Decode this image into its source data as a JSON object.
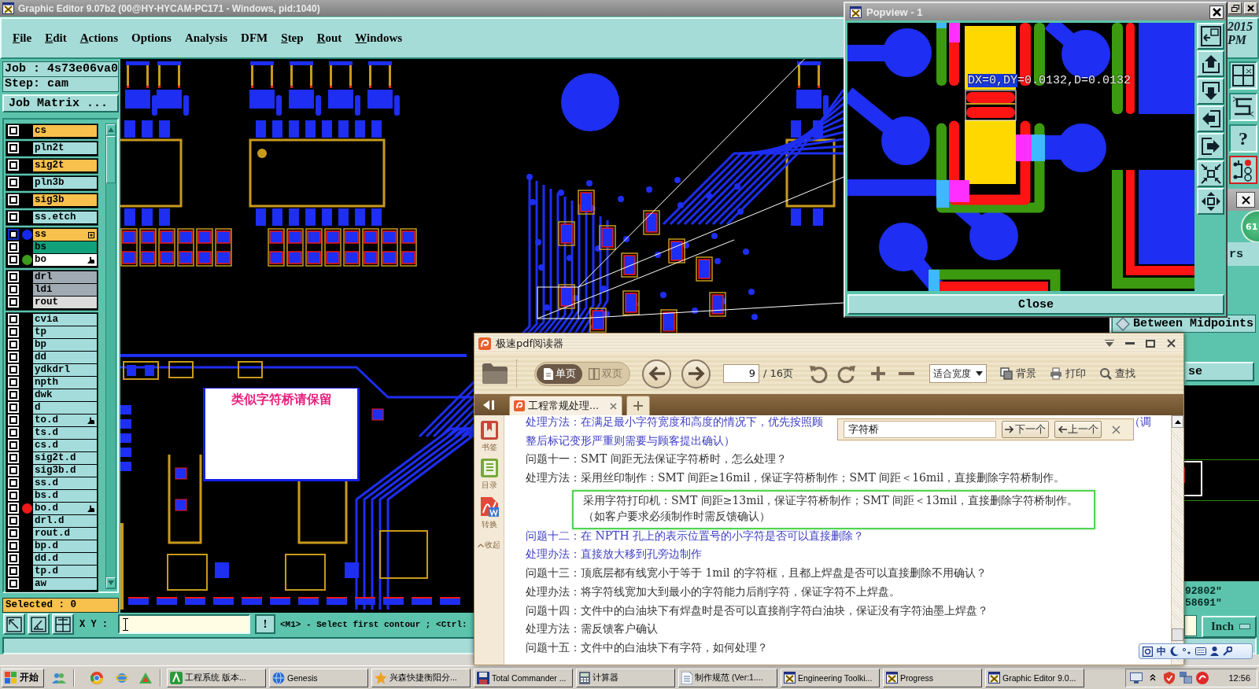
{
  "main_window": {
    "title": "Graphic Editor 9.07b2 (00@HY-HYCAM-PC171 - Windows, pid:1040)",
    "menu": [
      {
        "label": "File",
        "mnemonic": true
      },
      {
        "label": "Edit",
        "mnemonic": true
      },
      {
        "label": "Actions",
        "mnemonic": true
      },
      {
        "label": "Options",
        "mnemonic": false
      },
      {
        "label": "Analysis",
        "mnemonic": false
      },
      {
        "label": "DFM",
        "mnemonic": false
      },
      {
        "label": "Step",
        "mnemonic": true
      },
      {
        "label": "Rout",
        "mnemonic": true
      },
      {
        "label": "Windows",
        "mnemonic": true
      }
    ],
    "clock": {
      "date": "2015",
      "time": "PM"
    },
    "job_field": "Job : 4s73e06va0",
    "step_field": "Step: cam",
    "job_matrix_button": "Job Matrix ...",
    "layer_groups": [
      {
        "layers": [
          {
            "kind": "plain",
            "name": "cs",
            "color": "#f8c04c",
            "checked": false,
            "selected": false
          }
        ]
      },
      {
        "layers": [
          {
            "kind": "plain",
            "name": "pln2t",
            "color": "#a4dcdc",
            "checked": false,
            "selected": false
          }
        ]
      },
      {
        "layers": [
          {
            "kind": "plain",
            "name": "sig2t",
            "color": "#f8c04c",
            "checked": false,
            "selected": false
          }
        ]
      },
      {
        "layers": [
          {
            "kind": "plain",
            "name": "pln3b",
            "color": "#a4dcdc",
            "checked": false,
            "selected": false
          }
        ]
      },
      {
        "layers": [
          {
            "kind": "plain",
            "name": "sig3b",
            "color": "#f8c04c",
            "checked": false,
            "selected": false
          }
        ]
      },
      {
        "layers": [
          {
            "kind": "plain",
            "name": "ss.etch",
            "color": "#a4dcdc",
            "checked": false,
            "selected": false
          }
        ]
      },
      {
        "layers": [
          {
            "kind": "grid",
            "name": "ss",
            "color": "#f8c04c",
            "checked": false,
            "selected": true,
            "marker": {
              "color": "#1428f0"
            }
          },
          {
            "kind": "plain",
            "name": "bs",
            "color": "#10a07c",
            "checked": false,
            "selected": false
          },
          {
            "kind": "hand",
            "name": "bo",
            "color": "#ffffff",
            "checked": false,
            "selected": false,
            "marker": {
              "color": "#3c9a1c"
            }
          }
        ]
      },
      {
        "layers": [
          {
            "kind": "plain",
            "name": "drl",
            "color": "#a0aab2",
            "checked": false,
            "selected": false
          },
          {
            "kind": "plain",
            "name": "ldi",
            "color": "#a0aab2",
            "checked": false,
            "selected": false
          },
          {
            "kind": "plain",
            "name": "rout",
            "color": "#dcdcdc",
            "checked": false,
            "selected": false
          }
        ]
      },
      {
        "layers": [
          {
            "kind": "plain",
            "name": "cvia",
            "color": "#a4dcdc",
            "checked": false,
            "selected": false
          },
          {
            "kind": "plain",
            "name": "tp",
            "color": "#a4dcdc",
            "checked": false,
            "selected": false
          },
          {
            "kind": "plain",
            "name": "bp",
            "color": "#a4dcdc",
            "checked": false,
            "selected": false
          },
          {
            "kind": "plain",
            "name": "dd",
            "color": "#a4dcdc",
            "checked": false,
            "selected": false
          },
          {
            "kind": "plain",
            "name": "ydkdrl",
            "color": "#a4dcdc",
            "checked": false,
            "selected": false
          },
          {
            "kind": "plain",
            "name": "npth",
            "color": "#a4dcdc",
            "checked": false,
            "selected": false
          },
          {
            "kind": "plain",
            "name": "dwk",
            "color": "#a4dcdc",
            "checked": false,
            "selected": false
          },
          {
            "kind": "plain",
            "name": "d",
            "color": "#a4dcdc",
            "checked": false,
            "selected": false
          },
          {
            "kind": "hand",
            "name": "to.d",
            "color": "#a4dcdc",
            "checked": false,
            "selected": false
          },
          {
            "kind": "plain",
            "name": "ts.d",
            "color": "#a4dcdc",
            "checked": false,
            "selected": false
          },
          {
            "kind": "plain",
            "name": "cs.d",
            "color": "#a4dcdc",
            "checked": false,
            "selected": false
          },
          {
            "kind": "plain",
            "name": "sig2t.d",
            "color": "#a4dcdc",
            "checked": false,
            "selected": false
          },
          {
            "kind": "plain",
            "name": "sig3b.d",
            "color": "#a4dcdc",
            "checked": false,
            "selected": false
          },
          {
            "kind": "plain",
            "name": "ss.d",
            "color": "#a4dcdc",
            "checked": false,
            "selected": false
          },
          {
            "kind": "plain",
            "name": "bs.d",
            "color": "#a4dcdc",
            "checked": false,
            "selected": false
          },
          {
            "kind": "hand",
            "name": "bo.d",
            "color": "#a4dcdc",
            "checked": false,
            "selected": false,
            "marker": {
              "color": "#f01818"
            }
          },
          {
            "kind": "plain",
            "name": "drl.d",
            "color": "#a4dcdc",
            "checked": false,
            "selected": false
          },
          {
            "kind": "plain",
            "name": "rout.d",
            "color": "#a4dcdc",
            "checked": false,
            "selected": false
          },
          {
            "kind": "plain",
            "name": "bp.d",
            "color": "#a4dcdc",
            "checked": false,
            "selected": false
          },
          {
            "kind": "plain",
            "name": "dd.d",
            "color": "#a4dcdc",
            "checked": false,
            "selected": false
          },
          {
            "kind": "plain",
            "name": "tp.d",
            "color": "#a4dcdc",
            "checked": false,
            "selected": false
          },
          {
            "kind": "plain",
            "name": "aw",
            "color": "#a4dcdc",
            "checked": false,
            "selected": false
          }
        ]
      }
    ],
    "selected_count": "Selected : 0",
    "annotation": "类似字符桥请保留",
    "help_button": "?",
    "readout": [
      "92802\"",
      "58691\""
    ],
    "xy_label": "X Y :",
    "confirm_button": "!",
    "prompt": "<M1> - Select first contour ; <Ctrl:",
    "unit_button": "Inch"
  },
  "popview": {
    "title": "Popview - 1",
    "measurement": {
      "selected": "DX=0,DY",
      "rest": "=0.0132,D=0.0132"
    },
    "close_button": "Close"
  },
  "measure_dialog": {
    "badge": "61",
    "label": "rs",
    "options": [
      {
        "label": "Between Midpoints",
        "selected": false
      }
    ],
    "button": "se"
  },
  "pdf_reader": {
    "title": "极速pdf阅读器",
    "view_modes": [
      {
        "kind": "single",
        "label": "单页",
        "selected": true
      },
      {
        "kind": "double",
        "label": "双页",
        "selected": false
      }
    ],
    "page_input": "9",
    "page_total": "/ 16页",
    "fit_mode": "适合宽度",
    "tools": [
      {
        "kind": "background",
        "label": "背景"
      },
      {
        "kind": "print",
        "label": "打印"
      },
      {
        "kind": "search",
        "label": "查找"
      }
    ],
    "tabs": [
      {
        "label": "工程常规处理...",
        "selected": true
      }
    ],
    "side_tools": [
      {
        "kind": "bookmark",
        "label": "书签"
      },
      {
        "kind": "contents",
        "label": "目录"
      },
      {
        "kind": "convert",
        "label": "转换"
      }
    ],
    "collapse": "收起",
    "search": {
      "value": "字符桥",
      "next": "下一个",
      "previous": "上一个"
    },
    "content": [
      {
        "kind": "split",
        "text": "处理方法：在满足最小字符宽度和高度的情况下，优先按照顾",
        "tail": "（调",
        "color": "#3c3cc4"
      },
      {
        "kind": "line",
        "text": "整后标记变形严重则需要与顾客提出确认）",
        "color": "#3c3cc4"
      },
      {
        "kind": "line",
        "text": "问题十一：SMT 间距无法保证字符桥时，怎么处理？",
        "color": "#333333"
      },
      {
        "kind": "line",
        "text": "处理方法：采用丝印制作：SMT 间距≥16mil，保证字符桥制作；SMT 间距＜16mil，直接删除字符桥制作。",
        "color": "#333333"
      },
      {
        "kind": "framed",
        "lines": [
          "采用字符打印机：SMT 间距≥13mil，保证字符桥制作；SMT 间距＜13mil，直接删除字符桥制作。",
          "（如客户要求必须制作时需反馈确认）"
        ],
        "color": "#333333"
      },
      {
        "kind": "line",
        "text": "问题十二：在 NPTH 孔上的表示位置号的小字符是否可以直接删除？",
        "color": "#3c3cc4"
      },
      {
        "kind": "line",
        "text": "处理办法：直接放大移到孔旁边制作",
        "color": "#3c3cc4"
      },
      {
        "kind": "line",
        "text": "问题十三：顶底层都有线宽小于等于 1mil 的字符框，且都上焊盘是否可以直接删除不用确认？",
        "color": "#333333"
      },
      {
        "kind": "line",
        "text": "处理办法：将字符线宽加大到最小的字符能力后削字符，保证字符不上焊盘。",
        "color": "#333333"
      },
      {
        "kind": "line",
        "text": "问题十四：文件中的白油块下有焊盘时是否可以直接削字符白油块，保证没有字符油墨上焊盘？",
        "color": "#333333"
      },
      {
        "kind": "line",
        "text": "处理方法：需反馈客户确认",
        "color": "#333333"
      },
      {
        "kind": "line",
        "text": "问题十五：文件中的白油块下有字符，如何处理？",
        "color": "#333333"
      }
    ]
  },
  "taskbar": {
    "start": "开始",
    "tasks": [
      {
        "kind": "engineering",
        "label": "工程系统 版本..."
      },
      {
        "kind": "genesis",
        "label": "Genesis"
      },
      {
        "kind": "star",
        "label": "兴森快捷衡阳分..."
      },
      {
        "kind": "disk",
        "label": "Total Commander ..."
      },
      {
        "kind": "calculator",
        "label": "计算器"
      },
      {
        "kind": "document",
        "label": "制作规范 (Ver:1...."
      },
      {
        "kind": "editor",
        "label": "Engineering Toolki..."
      },
      {
        "kind": "editor",
        "label": "Progress"
      },
      {
        "kind": "editor",
        "label": "Graphic Editor 9.0..."
      }
    ],
    "clock": "12:56"
  },
  "ime_bar": {
    "mode": "中"
  }
}
